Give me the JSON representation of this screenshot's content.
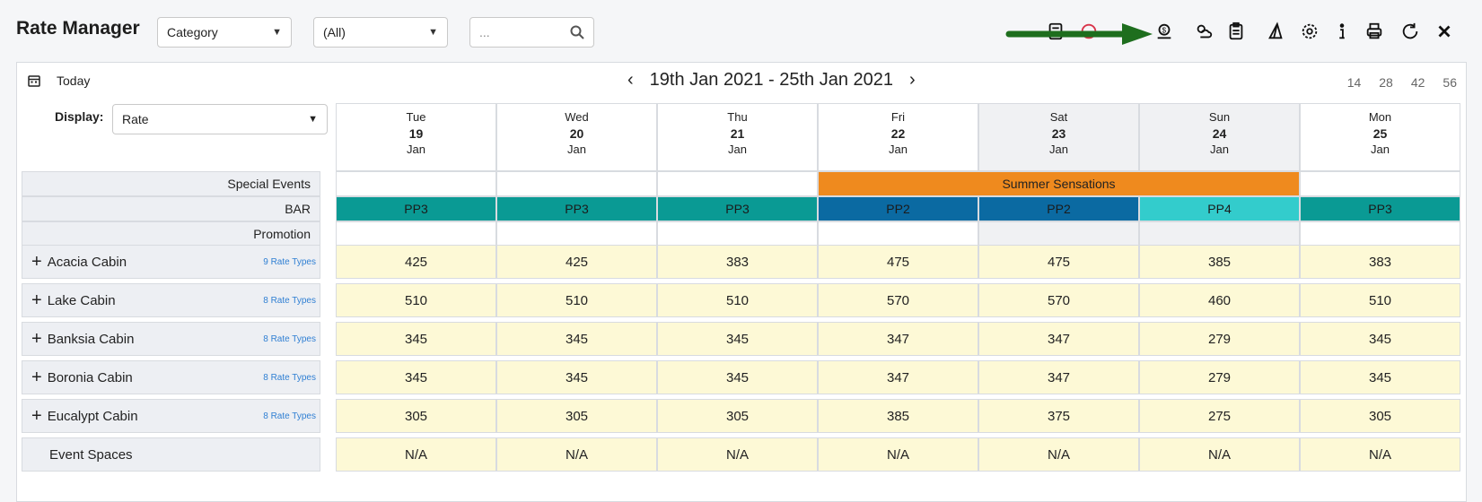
{
  "header": {
    "title": "Rate Manager",
    "filter_category": "Category",
    "filter_all": "(All)",
    "search_placeholder": "...",
    "toolbar_icons": [
      "calculator-icon",
      "help-icon",
      "money-icon",
      "weather-icon",
      "clipboard-icon",
      "sail-icon",
      "gear-icon",
      "info-icon",
      "print-icon",
      "refresh-icon",
      "close-icon"
    ]
  },
  "nav": {
    "today": "Today",
    "range": "19th Jan 2021 - 25th Jan 2021",
    "zooms": [
      "14",
      "28",
      "42",
      "56"
    ]
  },
  "display": {
    "label": "Display:",
    "value": "Rate"
  },
  "days": [
    {
      "dow": "Tue",
      "num": "19",
      "mon": "Jan",
      "weekend": false
    },
    {
      "dow": "Wed",
      "num": "20",
      "mon": "Jan",
      "weekend": false
    },
    {
      "dow": "Thu",
      "num": "21",
      "mon": "Jan",
      "weekend": false
    },
    {
      "dow": "Fri",
      "num": "22",
      "mon": "Jan",
      "weekend": false
    },
    {
      "dow": "Sat",
      "num": "23",
      "mon": "Jan",
      "weekend": true
    },
    {
      "dow": "Sun",
      "num": "24",
      "mon": "Jan",
      "weekend": true
    },
    {
      "dow": "Mon",
      "num": "25",
      "mon": "Jan",
      "weekend": false
    }
  ],
  "special_events": {
    "label": "Special Events",
    "event": "Summer Sensations",
    "event_color": "#ef8a1e"
  },
  "bar": {
    "label": "BAR",
    "values": [
      "PP3",
      "PP3",
      "PP3",
      "PP2",
      "PP2",
      "PP4",
      "PP3"
    ],
    "colors": [
      "#0a9a94",
      "#0a9a94",
      "#0a9a94",
      "#0b6aa2",
      "#0b6aa2",
      "#33cccc",
      "#0a9a94"
    ]
  },
  "promotion": {
    "label": "Promotion"
  },
  "rooms": [
    {
      "name": "Acacia Cabin",
      "types": "9 Rate Types",
      "rates": [
        "425",
        "425",
        "383",
        "475",
        "475",
        "385",
        "383"
      ]
    },
    {
      "name": "Lake Cabin",
      "types": "8 Rate Types",
      "rates": [
        "510",
        "510",
        "510",
        "570",
        "570",
        "460",
        "510"
      ]
    },
    {
      "name": "Banksia Cabin",
      "types": "8 Rate Types",
      "rates": [
        "345",
        "345",
        "345",
        "347",
        "347",
        "279",
        "345"
      ]
    },
    {
      "name": "Boronia Cabin",
      "types": "8 Rate Types",
      "rates": [
        "345",
        "345",
        "345",
        "347",
        "347",
        "279",
        "345"
      ]
    },
    {
      "name": "Eucalypt Cabin",
      "types": "8 Rate Types",
      "rates": [
        "305",
        "305",
        "305",
        "385",
        "375",
        "275",
        "305"
      ]
    },
    {
      "name": "Event Spaces",
      "types": "",
      "rates": [
        "N/A",
        "N/A",
        "N/A",
        "N/A",
        "N/A",
        "N/A",
        "N/A"
      ]
    }
  ]
}
